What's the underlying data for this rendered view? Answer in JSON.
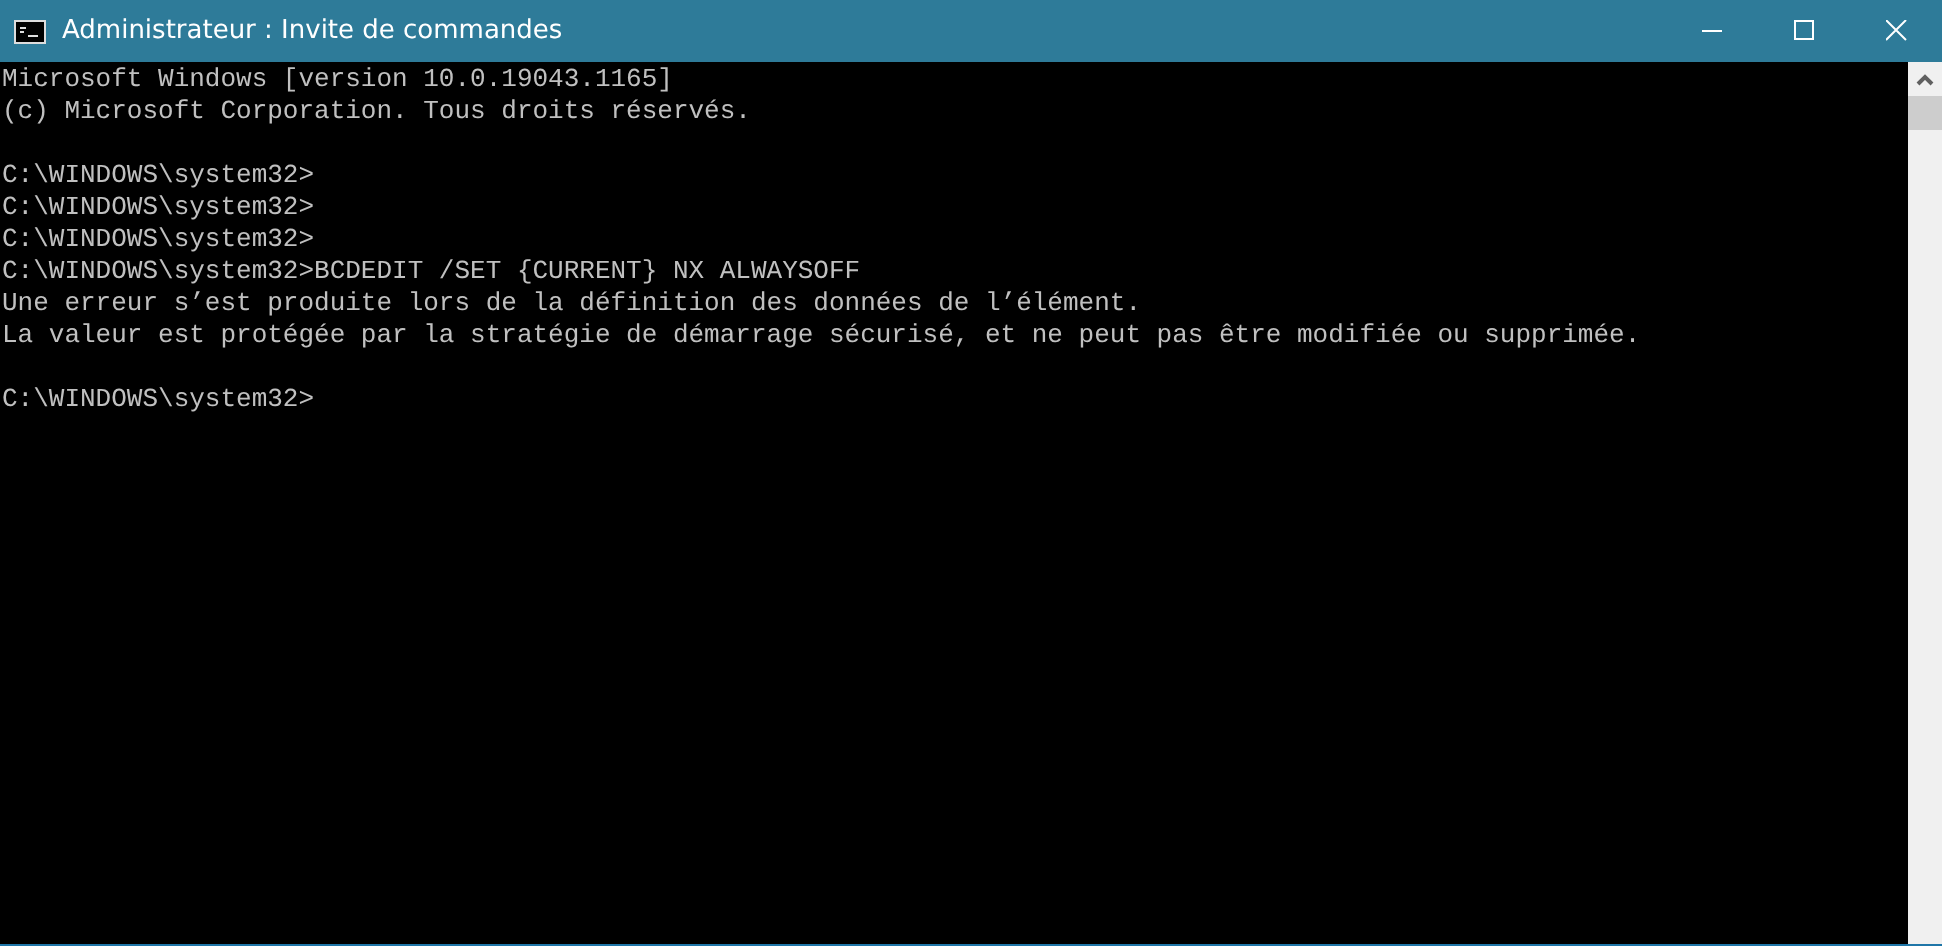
{
  "window": {
    "title": "Administrateur : Invite de commandes"
  },
  "console": {
    "blocks": [
      [
        "Microsoft Windows [version 10.0.19043.1165]",
        "(c) Microsoft Corporation. Tous droits réservés."
      ],
      [
        "C:\\WINDOWS\\system32>",
        "C:\\WINDOWS\\system32>",
        "C:\\WINDOWS\\system32>",
        "C:\\WINDOWS\\system32>BCDEDIT /SET {CURRENT} NX ALWAYSOFF",
        "Une erreur s’est produite lors de la définition des données de l’élément.",
        "La valeur est protégée par la stratégie de démarrage sécurisé, et ne peut pas être modifiée ou supprimée."
      ],
      [
        "C:\\WINDOWS\\system32>"
      ]
    ]
  }
}
